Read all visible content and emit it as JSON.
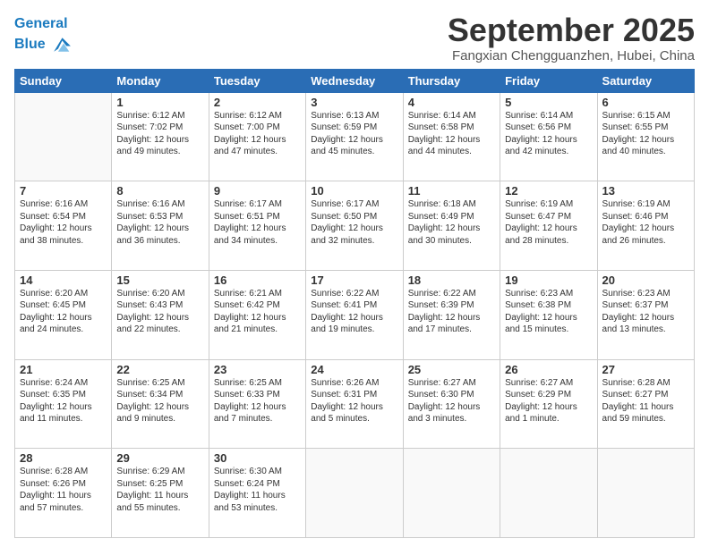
{
  "header": {
    "logo_line1": "General",
    "logo_line2": "Blue",
    "month_title": "September 2025",
    "subtitle": "Fangxian Chengguanzhen, Hubei, China"
  },
  "days_of_week": [
    "Sunday",
    "Monday",
    "Tuesday",
    "Wednesday",
    "Thursday",
    "Friday",
    "Saturday"
  ],
  "weeks": [
    [
      {
        "day": "",
        "info": ""
      },
      {
        "day": "1",
        "info": "Sunrise: 6:12 AM\nSunset: 7:02 PM\nDaylight: 12 hours\nand 49 minutes."
      },
      {
        "day": "2",
        "info": "Sunrise: 6:12 AM\nSunset: 7:00 PM\nDaylight: 12 hours\nand 47 minutes."
      },
      {
        "day": "3",
        "info": "Sunrise: 6:13 AM\nSunset: 6:59 PM\nDaylight: 12 hours\nand 45 minutes."
      },
      {
        "day": "4",
        "info": "Sunrise: 6:14 AM\nSunset: 6:58 PM\nDaylight: 12 hours\nand 44 minutes."
      },
      {
        "day": "5",
        "info": "Sunrise: 6:14 AM\nSunset: 6:56 PM\nDaylight: 12 hours\nand 42 minutes."
      },
      {
        "day": "6",
        "info": "Sunrise: 6:15 AM\nSunset: 6:55 PM\nDaylight: 12 hours\nand 40 minutes."
      }
    ],
    [
      {
        "day": "7",
        "info": "Sunrise: 6:16 AM\nSunset: 6:54 PM\nDaylight: 12 hours\nand 38 minutes."
      },
      {
        "day": "8",
        "info": "Sunrise: 6:16 AM\nSunset: 6:53 PM\nDaylight: 12 hours\nand 36 minutes."
      },
      {
        "day": "9",
        "info": "Sunrise: 6:17 AM\nSunset: 6:51 PM\nDaylight: 12 hours\nand 34 minutes."
      },
      {
        "day": "10",
        "info": "Sunrise: 6:17 AM\nSunset: 6:50 PM\nDaylight: 12 hours\nand 32 minutes."
      },
      {
        "day": "11",
        "info": "Sunrise: 6:18 AM\nSunset: 6:49 PM\nDaylight: 12 hours\nand 30 minutes."
      },
      {
        "day": "12",
        "info": "Sunrise: 6:19 AM\nSunset: 6:47 PM\nDaylight: 12 hours\nand 28 minutes."
      },
      {
        "day": "13",
        "info": "Sunrise: 6:19 AM\nSunset: 6:46 PM\nDaylight: 12 hours\nand 26 minutes."
      }
    ],
    [
      {
        "day": "14",
        "info": "Sunrise: 6:20 AM\nSunset: 6:45 PM\nDaylight: 12 hours\nand 24 minutes."
      },
      {
        "day": "15",
        "info": "Sunrise: 6:20 AM\nSunset: 6:43 PM\nDaylight: 12 hours\nand 22 minutes."
      },
      {
        "day": "16",
        "info": "Sunrise: 6:21 AM\nSunset: 6:42 PM\nDaylight: 12 hours\nand 21 minutes."
      },
      {
        "day": "17",
        "info": "Sunrise: 6:22 AM\nSunset: 6:41 PM\nDaylight: 12 hours\nand 19 minutes."
      },
      {
        "day": "18",
        "info": "Sunrise: 6:22 AM\nSunset: 6:39 PM\nDaylight: 12 hours\nand 17 minutes."
      },
      {
        "day": "19",
        "info": "Sunrise: 6:23 AM\nSunset: 6:38 PM\nDaylight: 12 hours\nand 15 minutes."
      },
      {
        "day": "20",
        "info": "Sunrise: 6:23 AM\nSunset: 6:37 PM\nDaylight: 12 hours\nand 13 minutes."
      }
    ],
    [
      {
        "day": "21",
        "info": "Sunrise: 6:24 AM\nSunset: 6:35 PM\nDaylight: 12 hours\nand 11 minutes."
      },
      {
        "day": "22",
        "info": "Sunrise: 6:25 AM\nSunset: 6:34 PM\nDaylight: 12 hours\nand 9 minutes."
      },
      {
        "day": "23",
        "info": "Sunrise: 6:25 AM\nSunset: 6:33 PM\nDaylight: 12 hours\nand 7 minutes."
      },
      {
        "day": "24",
        "info": "Sunrise: 6:26 AM\nSunset: 6:31 PM\nDaylight: 12 hours\nand 5 minutes."
      },
      {
        "day": "25",
        "info": "Sunrise: 6:27 AM\nSunset: 6:30 PM\nDaylight: 12 hours\nand 3 minutes."
      },
      {
        "day": "26",
        "info": "Sunrise: 6:27 AM\nSunset: 6:29 PM\nDaylight: 12 hours\nand 1 minute."
      },
      {
        "day": "27",
        "info": "Sunrise: 6:28 AM\nSunset: 6:27 PM\nDaylight: 11 hours\nand 59 minutes."
      }
    ],
    [
      {
        "day": "28",
        "info": "Sunrise: 6:28 AM\nSunset: 6:26 PM\nDaylight: 11 hours\nand 57 minutes."
      },
      {
        "day": "29",
        "info": "Sunrise: 6:29 AM\nSunset: 6:25 PM\nDaylight: 11 hours\nand 55 minutes."
      },
      {
        "day": "30",
        "info": "Sunrise: 6:30 AM\nSunset: 6:24 PM\nDaylight: 11 hours\nand 53 minutes."
      },
      {
        "day": "",
        "info": ""
      },
      {
        "day": "",
        "info": ""
      },
      {
        "day": "",
        "info": ""
      },
      {
        "day": "",
        "info": ""
      }
    ]
  ]
}
